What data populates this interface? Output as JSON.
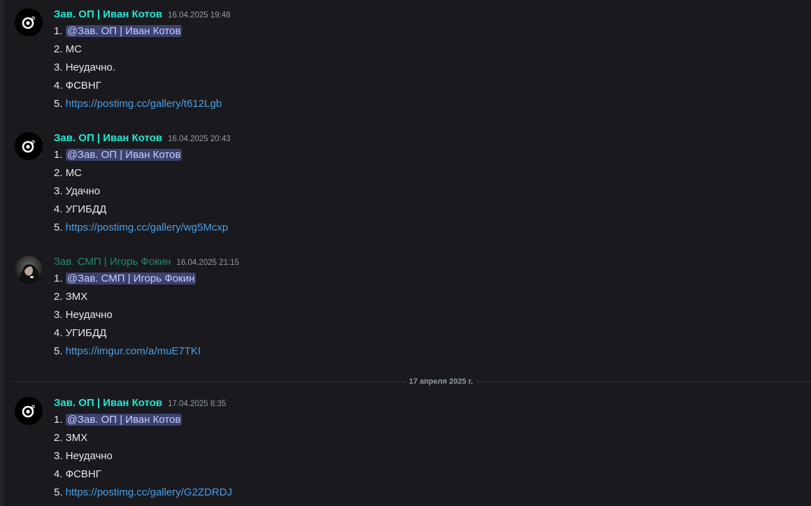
{
  "messages": [
    {
      "author": "Зав. ОП | Иван Котов",
      "timestamp": "16.04.2025 19:48",
      "avatar_icon": "camera-logo-icon",
      "lines": [
        {
          "num": "1.",
          "mention": "@Зав. ОП | Иван Котов"
        },
        {
          "num": "2.",
          "text": "МС"
        },
        {
          "num": "3.",
          "text": "Неудачно."
        },
        {
          "num": "4.",
          "text": "ФСВНГ"
        },
        {
          "num": "5.",
          "link": "https://postimg.cc/gallery/t612Lgb"
        }
      ]
    },
    {
      "author": "Зав. ОП | Иван Котов",
      "timestamp": "16.04.2025 20:43",
      "avatar_icon": "camera-logo-icon",
      "lines": [
        {
          "num": "1.",
          "mention": "@Зав. ОП | Иван Котов"
        },
        {
          "num": "2.",
          "text": "МС"
        },
        {
          "num": "3.",
          "text": "Удачно"
        },
        {
          "num": "4.",
          "text": "УГИБДД"
        },
        {
          "num": "5.",
          "link": "https://postimg.cc/gallery/wg5Mcxp"
        }
      ]
    },
    {
      "author": "Зав. СМП | Игорь Фокин",
      "timestamp": "16.04.2025 21:15",
      "avatar_icon": "user-photo-avatar",
      "lines": [
        {
          "num": "1.",
          "mention": "@Зав. СМП | Игорь Фокин"
        },
        {
          "num": "2.",
          "text": "ЗМХ"
        },
        {
          "num": "3.",
          "text": "Неудачно"
        },
        {
          "num": "4.",
          "text": "УГИБДД"
        },
        {
          "num": "5.",
          "link": "https://imgur.com/a/muE7TKI"
        }
      ]
    },
    {
      "author": "Зав. ОП | Иван Котов",
      "timestamp": "17.04.2025 8:35",
      "avatar_icon": "camera-logo-icon",
      "lines": [
        {
          "num": "1.",
          "mention": "@Зав. ОП | Иван Котов"
        },
        {
          "num": "2.",
          "text": "ЗМХ"
        },
        {
          "num": "3.",
          "text": "Неудачно"
        },
        {
          "num": "4.",
          "text": "ФСВНГ"
        },
        {
          "num": "5.",
          "link": "https://postimg.cc/gallery/G2ZDRDJ"
        }
      ]
    }
  ],
  "date_divider": "17 апреля 2025 г.",
  "colors": {
    "background": "#1a1a1e",
    "author_teal": "#1de9d4",
    "author_green": "#1f8b6e",
    "mention_bg": "#3c4270",
    "link": "#4a9fe8"
  }
}
